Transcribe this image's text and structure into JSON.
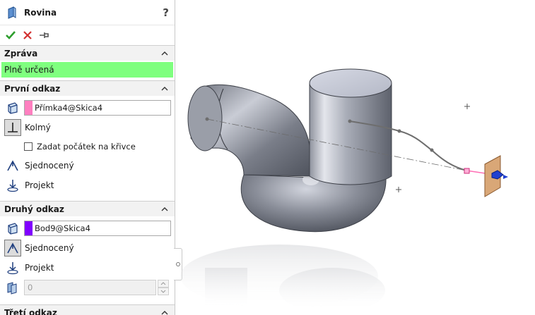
{
  "feature": {
    "title": "Rovina",
    "help": "?"
  },
  "message": {
    "header": "Zpráva",
    "text": "Plně určená",
    "color": "#7fff7f"
  },
  "first_ref": {
    "header": "První odkaz",
    "selection": "Přímka4@Skica4",
    "swatch": "#ff80c0",
    "options": {
      "perpendicular": "Kolmý",
      "origin_on_curve": "Zadat počátek na křivce",
      "coincident": "Sjednocený",
      "project": "Projekt"
    }
  },
  "second_ref": {
    "header": "Druhý odkaz",
    "selection": "Bod9@Skica4",
    "swatch": "#8000ff",
    "options": {
      "coincident": "Sjednocený",
      "project": "Projekt"
    },
    "count_value": "0"
  },
  "third_ref": {
    "header": "Třetí odkaz"
  }
}
